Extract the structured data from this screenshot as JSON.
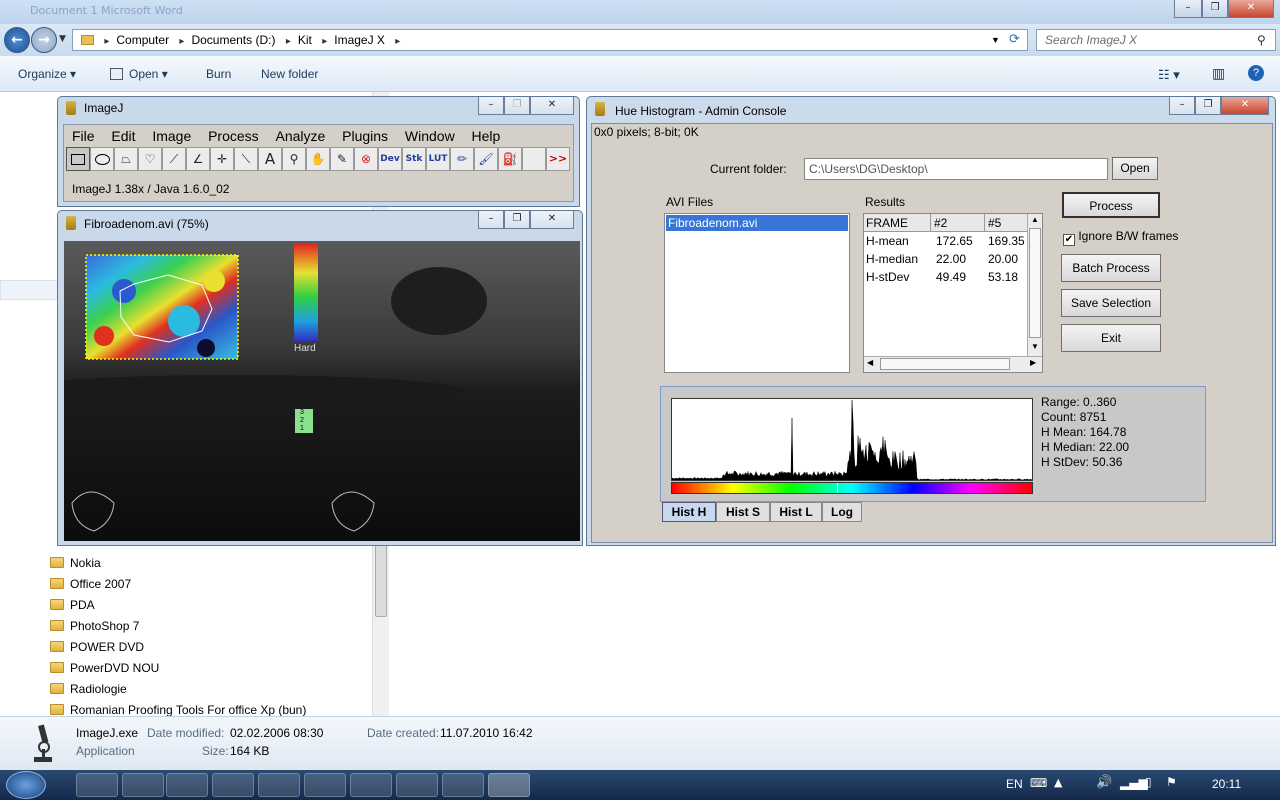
{
  "explorer": {
    "title_faded": "Document 1 Microsoft Word",
    "path": [
      "Computer",
      "Documents (D:)",
      "Kit",
      "ImageJ X"
    ],
    "search_placeholder": "Search ImageJ X",
    "toolbar": {
      "organize": "Organize",
      "open": "Open",
      "burn": "Burn",
      "new_folder": "New folder"
    },
    "folders": [
      "Nokia",
      "Office 2007",
      "PDA",
      "PhotoShop 7",
      "POWER DVD",
      "PowerDVD NOU",
      "Radiologie",
      "Romanian Proofing Tools For office Xp (bun)"
    ],
    "details": {
      "name": "ImageJ.exe",
      "type": "Application",
      "date_modified_label": "Date modified:",
      "date_modified": "02.02.2006 08:30",
      "size_label": "Size:",
      "size": "164 KB",
      "date_created_label": "Date created:",
      "date_created": "11.07.2010 16:42"
    }
  },
  "imagej": {
    "title": "ImageJ",
    "menu": [
      "File",
      "Edit",
      "Image",
      "Process",
      "Analyze",
      "Plugins",
      "Window",
      "Help"
    ],
    "tools": [
      "rectangle-tool",
      "oval-tool",
      "polygon-tool",
      "freehand-tool",
      "line-tool",
      "angle-tool",
      "point-tool",
      "wand-tool",
      "text-tool",
      "magnifier-tool",
      "hand-tool",
      "color-picker-tool",
      "stop-tool",
      "dev-tool",
      "stk-tool",
      "lut-tool",
      "pencil-tool",
      "brush-tool",
      "flood-fill-tool",
      "blank-tool",
      "more-tools"
    ],
    "tool_labels": {
      "dev": "Dev",
      "stk": "Stk",
      "lut": "LUT",
      "text": "A",
      "more": ">>"
    },
    "status": "ImageJ 1.38x / Java 1.6.0_02"
  },
  "image_window": {
    "title": "Fibroadenom.avi (75%)",
    "colorbar_label": "Hard",
    "scale_marks": [
      "3",
      "2",
      "1"
    ]
  },
  "hue": {
    "title": "Hue Histogram - Admin Console",
    "info": "0x0 pixels; 8-bit; 0K",
    "current_folder_label": "Current folder:",
    "current_folder": "C:\\Users\\DG\\Desktop\\",
    "open_btn": "Open",
    "avi_files_label": "AVI Files",
    "avi_files": [
      "Fibroadenom.avi"
    ],
    "results_label": "Results",
    "results_headers": [
      "FRAME",
      "#2",
      "#5"
    ],
    "results_rows": [
      [
        "H-mean",
        "172.65",
        "169.35"
      ],
      [
        "H-median",
        "22.00",
        "20.00"
      ],
      [
        "H-stDev",
        "49.49",
        "53.18"
      ]
    ],
    "buttons": {
      "process": "Process",
      "batch": "Batch Process",
      "save": "Save Selection",
      "exit": "Exit"
    },
    "ignore_bw": "Ignore B/W frames",
    "ignore_bw_checked": true,
    "stats": [
      "Range: 0..360",
      "Count: 8751",
      "H Mean: 164.78",
      "H Median: 22.00",
      "H StDev: 50.36"
    ],
    "tabs": [
      "Hist H",
      "Hist S",
      "Hist L",
      "Log"
    ],
    "active_tab": "Hist H"
  },
  "taskbar": {
    "lang": "EN",
    "time": "20:11"
  },
  "colors": {
    "explorer_blue": "#c9dbef",
    "imagej_gray": "#d4d0c8",
    "selection_blue": "#3875d7"
  }
}
